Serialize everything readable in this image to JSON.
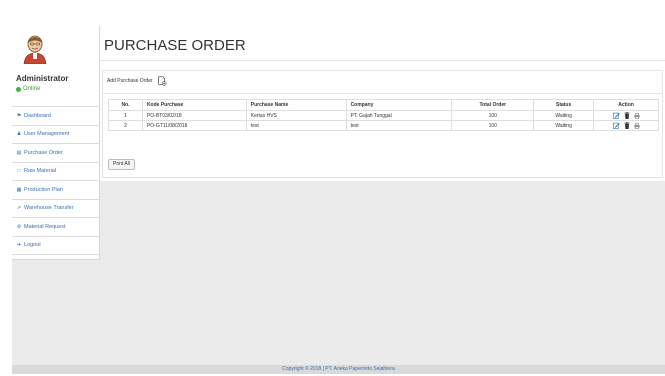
{
  "user": {
    "name": "Administrator",
    "status": "Online"
  },
  "sidebar": {
    "items": [
      {
        "label": "Dashboard",
        "icon": "home-icon"
      },
      {
        "label": "User Management",
        "icon": "user-icon"
      },
      {
        "label": "Purchase Order",
        "icon": "cart-icon"
      },
      {
        "label": "Raw Material",
        "icon": "box-icon"
      },
      {
        "label": "Production Plan",
        "icon": "calendar-icon"
      },
      {
        "label": "Warehouse Transfer",
        "icon": "transfer-icon"
      },
      {
        "label": "Material Request",
        "icon": "request-icon"
      },
      {
        "label": "Logout",
        "icon": "logout-icon"
      }
    ]
  },
  "page": {
    "title": "PURCHASE ORDER",
    "add_label": "Add Purchase Order",
    "print_label": "Print All"
  },
  "table": {
    "headers": [
      "No.",
      "Kode Purchase",
      "Purchase Name",
      "Company",
      "Total Order",
      "Status",
      "Action"
    ],
    "rows": [
      {
        "no": "1",
        "kode": "PO-BT03/02/18",
        "name": "Kertas HVS",
        "company": "PT. Gajah Tunggal",
        "total": "100",
        "status": "Waiting"
      },
      {
        "no": "2",
        "kode": "PO-GT11/08/2018",
        "name": "test",
        "company": "test",
        "total": "100",
        "status": "Waiting"
      }
    ]
  },
  "footer": {
    "copyright": "Copyright © 2018 | PT. Aneka Paperindo Sejahtera"
  },
  "colors": {
    "link": "#3a6fb5",
    "online": "#3cb44a",
    "background": "#ebebeb"
  }
}
